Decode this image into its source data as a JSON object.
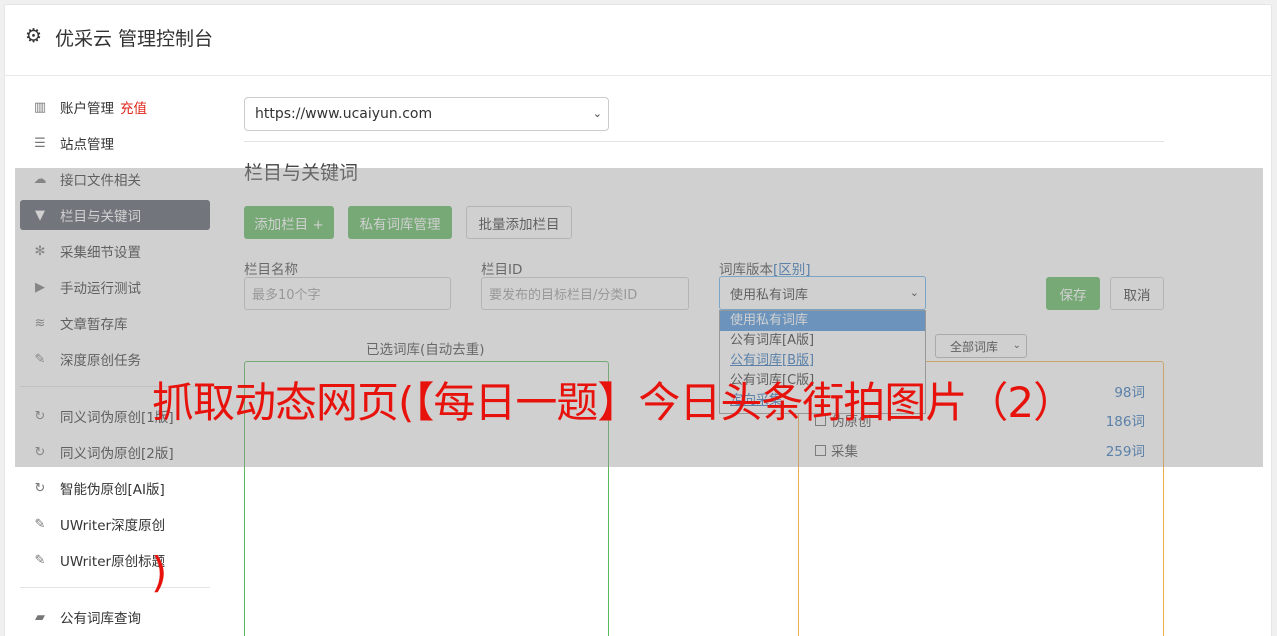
{
  "header": {
    "title": "优采云 管理控制台",
    "icon": "gear-icon"
  },
  "sidebar": {
    "items": [
      {
        "label": "账户管理",
        "badge": "充值",
        "icon": "bar-chart-icon"
      },
      {
        "label": "站点管理",
        "icon": "server-icon"
      },
      {
        "label": "接口文件相关",
        "icon": "cloud-upload-icon"
      },
      {
        "label": "栏目与关键词",
        "icon": "filter-icon",
        "active": true
      },
      {
        "label": "采集细节设置",
        "icon": "cogs-icon"
      },
      {
        "label": "手动运行测试",
        "icon": "play-circle-icon"
      },
      {
        "label": "文章暂存库",
        "icon": "database-icon"
      },
      {
        "label": "深度原创任务",
        "icon": "edit-icon"
      }
    ],
    "items2": [
      {
        "label": "同义词伪原创[1版]",
        "icon": "refresh-icon"
      },
      {
        "label": "同义词伪原创[2版]",
        "icon": "refresh-icon"
      },
      {
        "label": "智能伪原创[AI版]",
        "icon": "refresh-icon"
      },
      {
        "label": "UWriter深度原创",
        "icon": "edit-icon"
      },
      {
        "label": "UWriter原创标题",
        "icon": "edit-icon"
      }
    ],
    "items3": [
      {
        "label": "公有词库查询",
        "icon": "book-icon"
      }
    ]
  },
  "main": {
    "site_select": "https://www.ucaiyun.com",
    "section_title": "栏目与关键词",
    "buttons": {
      "add_column": "添加栏目 +",
      "private_lib": "私有词库管理",
      "batch_add": "批量添加栏目",
      "save": "保存",
      "cancel": "取消"
    },
    "fields": {
      "column_name_label": "栏目名称",
      "column_name_placeholder": "最多10个字",
      "column_id_label": "栏目ID",
      "column_id_placeholder": "要发布的目标栏目/分类ID",
      "lib_version_label": "词库版本",
      "lib_version_link": "[区别]",
      "lib_version_value": "使用私有词库"
    },
    "dropdown_options": [
      "使用私有词库",
      "公有词库[A版]",
      "公有词库[B版]",
      "公有词库[C版]",
      "定向采集"
    ],
    "selected_lib_title": "已选词库(自动去重)",
    "filter_select": "全部词库",
    "libraries": [
      {
        "name": "",
        "count": "98词"
      },
      {
        "name": "伪原创",
        "count": "186词"
      },
      {
        "name": "采集",
        "count": "259词"
      }
    ]
  },
  "banner": {
    "text": "抓取动态网页(【每日一题】今日头条街拍图片（2）",
    "tail": ")"
  }
}
